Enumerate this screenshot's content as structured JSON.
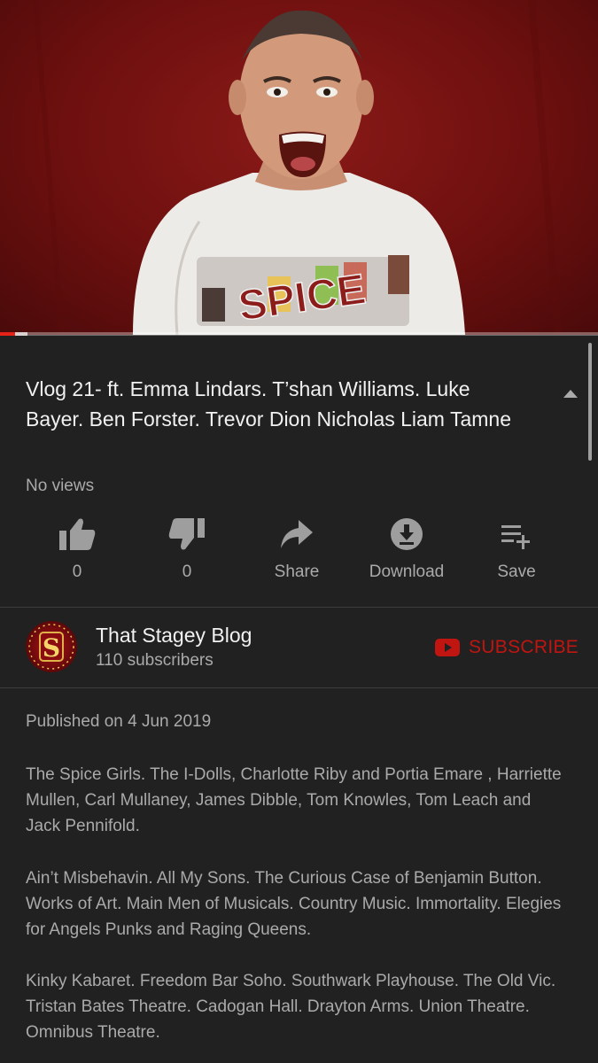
{
  "video": {
    "shirt_text": "SPICE",
    "progress_fraction": 0.025
  },
  "title": "Vlog 21- ft. Emma Lindars. T’shan Williams. Luke Bayer. Ben Forster. Trevor Dion Nicholas Liam Tamne",
  "views": "No views",
  "actions": {
    "like_count": "0",
    "dislike_count": "0",
    "share_label": "Share",
    "download_label": "Download",
    "save_label": "Save"
  },
  "channel": {
    "name": "That Stagey Blog",
    "subscribers": "110 subscribers",
    "avatar_letter": "S",
    "subscribe_label": "SUBSCRIBE",
    "subscribe_color": "#c01510"
  },
  "published": "Published on 4 Jun 2019",
  "description": [
    "The Spice Girls. The I-Dolls, Charlotte Riby and Portia Emare , Harriette Mullen, Carl Mullaney, James Dibble, Tom Knowles, Tom Leach and Jack Pennifold.",
    "Ain’t Misbehavin. All My Sons. The Curious Case of Benjamin Button. Works of Art. Main Men of Musicals. Country Music. Immortality. Elegies for Angels Punks and Raging Queens.",
    "Kinky Kabaret. Freedom Bar Soho. Southwark Playhouse. The Old Vic. Tristan Bates Theatre. Cadogan Hall. Drayton Arms. Union Theatre. Omnibus Theatre."
  ],
  "icons": {
    "like": "thumbs-up-icon",
    "dislike": "thumbs-down-icon",
    "share": "share-arrow-icon",
    "download": "download-icon",
    "save": "playlist-add-icon",
    "collapse": "chevron-up-icon",
    "subscribe": "youtube-play-icon"
  }
}
